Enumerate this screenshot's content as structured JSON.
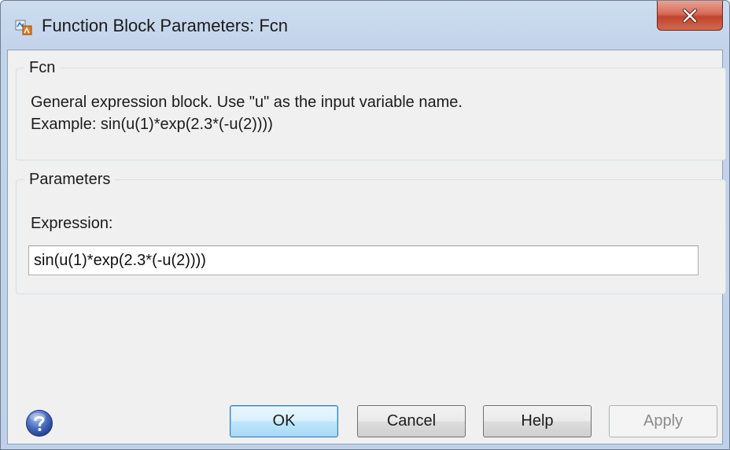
{
  "window": {
    "title": "Function Block Parameters: Fcn",
    "close_icon": "close-x-icon",
    "app_icon": "simulink-block-icon"
  },
  "fcn_group": {
    "legend": "Fcn",
    "description_line1": "General expression block. Use \"u\" as the input variable name.",
    "description_line2": "Example: sin(u(1)*exp(2.3*(-u(2))))"
  },
  "parameters_group": {
    "legend": "Parameters",
    "expression_label": "Expression:",
    "expression_value": "sin(u(1)*exp(2.3*(-u(2))))"
  },
  "footer": {
    "help_icon": "question-mark-icon",
    "ok_label": "OK",
    "cancel_label": "Cancel",
    "help_label": "Help",
    "apply_label": "Apply",
    "apply_enabled": false
  },
  "colors": {
    "titlebar": "#c3d4ea",
    "close_button": "#c2432c",
    "ok_button_accent": "#3c7fb1",
    "dialog_body": "#f0f0f0"
  }
}
